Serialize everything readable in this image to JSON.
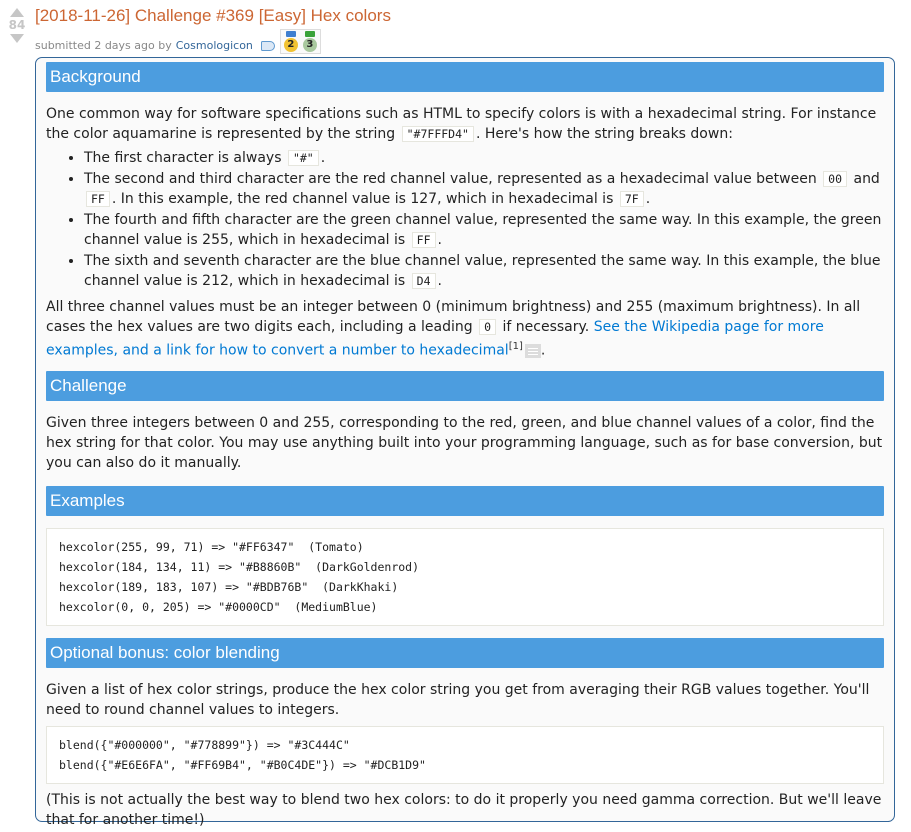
{
  "post": {
    "score": "84",
    "title": "[2018-11-26] Challenge #369 [Easy] Hex colors",
    "submitted": "submitted 2 days ago by",
    "author": "Cosmologicon",
    "badges": [
      "2",
      "3"
    ]
  },
  "body": {
    "background": {
      "heading": "Background",
      "intro_a": "One common way for software specifications such as HTML to specify colors is with a hexadecimal string. For instance the color aquamarine is represented by the string",
      "intro_code": "\"#7FFFD4\"",
      "intro_b": ". Here's how the string breaks down:",
      "b1_a": "The first character is always",
      "b1_code": "\"#\"",
      "b1_b": ".",
      "b2_a": "The second and third character are the red channel value, represented as a hexadecimal value between",
      "b2_code1": "00",
      "b2_mid": "and",
      "b2_code2": "FF",
      "b2_b": ". In this example, the red channel value is 127, which in hexadecimal is",
      "b2_code3": "7F",
      "b2_c": ".",
      "b3_a": "The fourth and fifth character are the green channel value, represented the same way. In this example, the green channel value is 255, which in hexadecimal is",
      "b3_code": "FF",
      "b3_b": ".",
      "b4_a": "The sixth and seventh character are the blue channel value, represented the same way. In this example, the blue channel value is 212, which in hexadecimal is",
      "b4_code": "D4",
      "b4_b": ".",
      "range_a": "All three channel values must be an integer between 0 (minimum brightness) and 255 (maximum brightness). In all cases the hex values are two digits each, including a leading",
      "range_code": "0",
      "range_b": "if necessary.",
      "link": "See the Wikipedia page for more examples, and a link for how to convert a number to hexadecimal",
      "link_sup": "[1]",
      "range_end": "."
    },
    "challenge": {
      "heading": "Challenge",
      "text": "Given three integers between 0 and 255, corresponding to the red, green, and blue channel values of a color, find the hex string for that color. You may use anything built into your programming language, such as for base conversion, but you can also do it manually."
    },
    "examples": {
      "heading": "Examples",
      "lines": [
        "hexcolor(255, 99, 71) => \"#FF6347\"  (Tomato)",
        "hexcolor(184, 134, 11) => \"#B8860B\"  (DarkGoldenrod)",
        "hexcolor(189, 183, 107) => \"#BDB76B\"  (DarkKhaki)",
        "hexcolor(0, 0, 205) => \"#0000CD\"  (MediumBlue)"
      ]
    },
    "bonus": {
      "heading": "Optional bonus: color blending",
      "text": "Given a list of hex color strings, produce the hex color string you get from averaging their RGB values together. You'll need to round channel values to integers.",
      "lines": [
        "blend({\"#000000\", \"#778899\"}) => \"#3C444C\"",
        "blend({\"#E6E6FA\", \"#FF69B4\", \"#B0C4DE\"}) => \"#DCB1D9\""
      ],
      "note": "(This is not actually the best way to blend two hex colors: to do it properly you need gamma correction. But we'll leave that for another time!)"
    }
  },
  "colors": {
    "heading_bg": "#4c9ddf",
    "title": "#cc6633",
    "link": "#0079d3"
  }
}
